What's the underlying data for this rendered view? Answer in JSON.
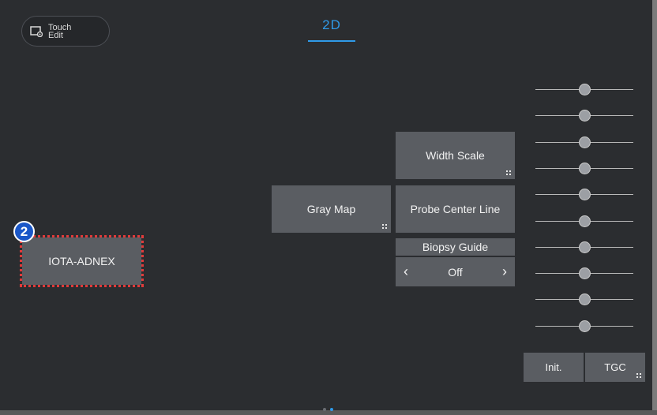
{
  "touch_edit": {
    "label": "Touch\nEdit"
  },
  "tab": {
    "title": "2D"
  },
  "buttons": {
    "width_scale": "Width Scale",
    "gray_map": "Gray Map",
    "probe_center_line": "Probe Center Line",
    "iota_adnex": "IOTA-ADNEX",
    "init": "Init.",
    "tgc": "TGC"
  },
  "biopsy_guide": {
    "label": "Biopsy Guide",
    "value": "Off",
    "prev_icon": "chevron-left",
    "next_icon": "chevron-right"
  },
  "callout": {
    "number": "2"
  },
  "tgc_sliders": {
    "count": 10
  },
  "pager": {
    "pages": 2,
    "current": 2
  },
  "colors": {
    "accent": "#2f9ae8",
    "highlight": "#e23a3a",
    "badge": "#1a57c8"
  }
}
